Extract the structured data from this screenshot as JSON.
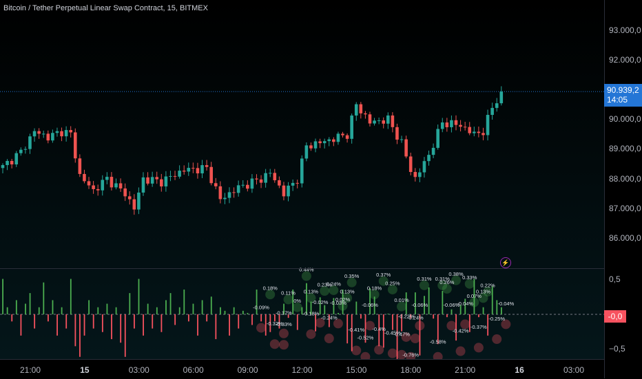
{
  "title": "Bitcoin / Tether Perpetual Linear Swap Contract, 15, BITMEX",
  "colors": {
    "up": "#26a69a",
    "down": "#ef5350",
    "hist_up": "#4caf50",
    "hist_down": "#f7525f",
    "last_price_bg": "#2476d6"
  },
  "last_price": {
    "value": "90.939,2",
    "countdown": "14:05"
  },
  "indicator_last": "-0,0",
  "price_axis": [
    "93.000,0",
    "92.000,0",
    "90.000,0",
    "89.000,0",
    "88.000,0",
    "87.000,0",
    "86.000,0"
  ],
  "indicator_axis": [
    "0,5",
    "−0,5"
  ],
  "time_axis": [
    {
      "label": "21:00",
      "bold": false
    },
    {
      "label": "15",
      "bold": true
    },
    {
      "label": "03:00",
      "bold": false
    },
    {
      "label": "06:00",
      "bold": false
    },
    {
      "label": "09:00",
      "bold": false
    },
    {
      "label": "12:00",
      "bold": false
    },
    {
      "label": "15:00",
      "bold": false
    },
    {
      "label": "18:00",
      "bold": false
    },
    {
      "label": "21:00",
      "bold": false
    },
    {
      "label": "16",
      "bold": true
    },
    {
      "label": "03:00",
      "bold": false
    }
  ],
  "alert_icon": "lightning-icon",
  "chart_data": {
    "type": "candlestick",
    "price_path": [
      [
        0,
        88400
      ],
      [
        4,
        88900
      ],
      [
        7,
        89600
      ],
      [
        10,
        89400
      ],
      [
        13,
        89600
      ],
      [
        15,
        89500
      ],
      [
        17,
        88100
      ],
      [
        20,
        87600
      ],
      [
        23,
        88000
      ],
      [
        27,
        87500
      ],
      [
        29,
        87000
      ],
      [
        31,
        88000
      ],
      [
        35,
        87900
      ],
      [
        40,
        88300
      ],
      [
        45,
        88350
      ],
      [
        48,
        87300
      ],
      [
        52,
        87700
      ],
      [
        57,
        88000
      ],
      [
        59,
        88200
      ],
      [
        62,
        87500
      ],
      [
        65,
        88000
      ],
      [
        67,
        89100
      ],
      [
        72,
        89300
      ],
      [
        76,
        89500
      ],
      [
        78,
        90500
      ],
      [
        81,
        89900
      ],
      [
        85,
        90000
      ],
      [
        88,
        89200
      ],
      [
        90,
        88300
      ],
      [
        91,
        88000
      ],
      [
        94,
        88800
      ],
      [
        97,
        89900
      ],
      [
        101,
        89800
      ],
      [
        104,
        89500
      ],
      [
        106,
        89600
      ],
      [
        108,
        90400
      ],
      [
        110,
        90939
      ]
    ],
    "histogram": [
      0.5,
      0.1,
      -0.1,
      0.2,
      -0.3,
      0.15,
      0.3,
      -0.2,
      0.1,
      0.45,
      -0.1,
      0.2,
      -0.3,
      0.1,
      -0.2,
      0.5,
      -0.45,
      -0.6,
      -0.3,
      0.2,
      -0.2,
      0.1,
      -0.25,
      0.15,
      -0.35,
      0.1,
      -0.4,
      -0.6,
      0.3,
      -0.2,
      0.5,
      -0.3,
      0.15,
      -0.2,
      0.1,
      -0.25,
      0.2,
      0.3,
      -0.15,
      0.1,
      0.35,
      -0.1,
      0.15,
      -0.3,
      0.2,
      -0.1,
      0.25,
      -0.35,
      0.1,
      0.05,
      -0.3,
      0.1,
      -0.2,
      0.05,
      0.02,
      -0.15,
      0.35,
      -0.1,
      -0.3,
      -0.25,
      -0.1,
      -0.2,
      0.15,
      -0.05,
      0.35,
      -0.22,
      0.1,
      0.44,
      0.18,
      -0.24,
      0.24,
      0.13,
      -0.18,
      0.23,
      0.02,
      0.35,
      -0.41,
      -0.52,
      0.18,
      -0.06,
      -0.4,
      0.37,
      0.25,
      -0.45,
      -0.47,
      0.01,
      -0.22,
      -0.76,
      -0.24,
      0.31,
      -0.06,
      0.31,
      -0.58,
      0.26,
      0.38,
      -0.06,
      -0.42,
      0.33,
      -0.04,
      0.07,
      -0.37,
      0.13,
      0.22,
      -0.25,
      0.5,
      -0.04,
      0.1,
      -0.3,
      0.4,
      0.2,
      0.1
    ],
    "pct_labels": [
      {
        "text": "0.18%",
        "bar": 59,
        "v": 0.18
      },
      {
        "text": "0.44%",
        "bar": 67,
        "v": 0.44
      },
      {
        "text": "0.11%",
        "bar": 63,
        "v": 0.11
      },
      {
        "text": "0%",
        "bar": 65,
        "v": 0.0
      },
      {
        "text": "0.13%",
        "bar": 68,
        "v": 0.13
      },
      {
        "text": "0.23%",
        "bar": 71,
        "v": 0.23
      },
      {
        "text": "0.24%",
        "bar": 73,
        "v": 0.24
      },
      {
        "text": "0.13%",
        "bar": 76,
        "v": 0.13
      },
      {
        "text": "0.35%",
        "bar": 77,
        "v": 0.35
      },
      {
        "text": "0.02%",
        "bar": 75,
        "v": 0.02
      },
      {
        "text": "-0.02%",
        "bar": 70,
        "v": -0.02
      },
      {
        "text": "-0.03%",
        "bar": 74,
        "v": -0.03
      },
      {
        "text": "-0.09%",
        "bar": 57,
        "v": -0.09
      },
      {
        "text": "-0.17%",
        "bar": 62,
        "v": -0.17
      },
      {
        "text": "-0.18%",
        "bar": 68,
        "v": -0.18
      },
      {
        "text": "-0.24%",
        "bar": 72,
        "v": -0.24
      },
      {
        "text": "-0.32%",
        "bar": 60,
        "v": -0.32
      },
      {
        "text": "-0.33%",
        "bar": 62,
        "v": -0.33
      },
      {
        "text": "0.18%",
        "bar": 82,
        "v": 0.18
      },
      {
        "text": "0.37%",
        "bar": 84,
        "v": 0.37
      },
      {
        "text": "0.25%",
        "bar": 86,
        "v": 0.25
      },
      {
        "text": "-0.06%",
        "bar": 81,
        "v": -0.06
      },
      {
        "text": "0.01%",
        "bar": 88,
        "v": 0.01
      },
      {
        "text": "-0.22%",
        "bar": 89,
        "v": -0.22
      },
      {
        "text": "-0.24%",
        "bar": 91,
        "v": -0.24
      },
      {
        "text": "-0.41%",
        "bar": 78,
        "v": -0.41
      },
      {
        "text": "-0.52%",
        "bar": 80,
        "v": -0.52
      },
      {
        "text": "-0.4%",
        "bar": 83,
        "v": -0.4
      },
      {
        "text": "-0.45%",
        "bar": 86,
        "v": -0.45
      },
      {
        "text": "-0.47%",
        "bar": 88,
        "v": -0.47
      },
      {
        "text": "-0.76%",
        "bar": 90,
        "v": -0.76
      },
      {
        "text": "-0.06%",
        "bar": 92,
        "v": -0.06
      },
      {
        "text": "0.31%",
        "bar": 93,
        "v": 0.31
      },
      {
        "text": "-0.58%",
        "bar": 96,
        "v": -0.58
      },
      {
        "text": "0.31%",
        "bar": 97,
        "v": 0.31
      },
      {
        "text": "0.26%",
        "bar": 98,
        "v": 0.26
      },
      {
        "text": "0.38%",
        "bar": 100,
        "v": 0.38
      },
      {
        "text": "-0.06%",
        "bar": 99,
        "v": -0.06
      },
      {
        "text": "-0.04%",
        "bar": 102,
        "v": -0.04
      },
      {
        "text": "-0.42%",
        "bar": 101,
        "v": -0.42
      },
      {
        "text": "0.33%",
        "bar": 103,
        "v": 0.33
      },
      {
        "text": "0.07%",
        "bar": 104,
        "v": 0.07
      },
      {
        "text": "-0.37%",
        "bar": 105,
        "v": -0.37
      },
      {
        "text": "0.13%",
        "bar": 106,
        "v": 0.13
      },
      {
        "text": "0.22%",
        "bar": 107,
        "v": 0.22
      },
      {
        "text": "-0.25%",
        "bar": 109,
        "v": -0.25
      },
      {
        "text": "-0.04%",
        "bar": 111,
        "v": -0.04
      }
    ],
    "price_range": [
      85500,
      93500
    ],
    "indicator_range": [
      -0.65,
      0.65
    ]
  }
}
